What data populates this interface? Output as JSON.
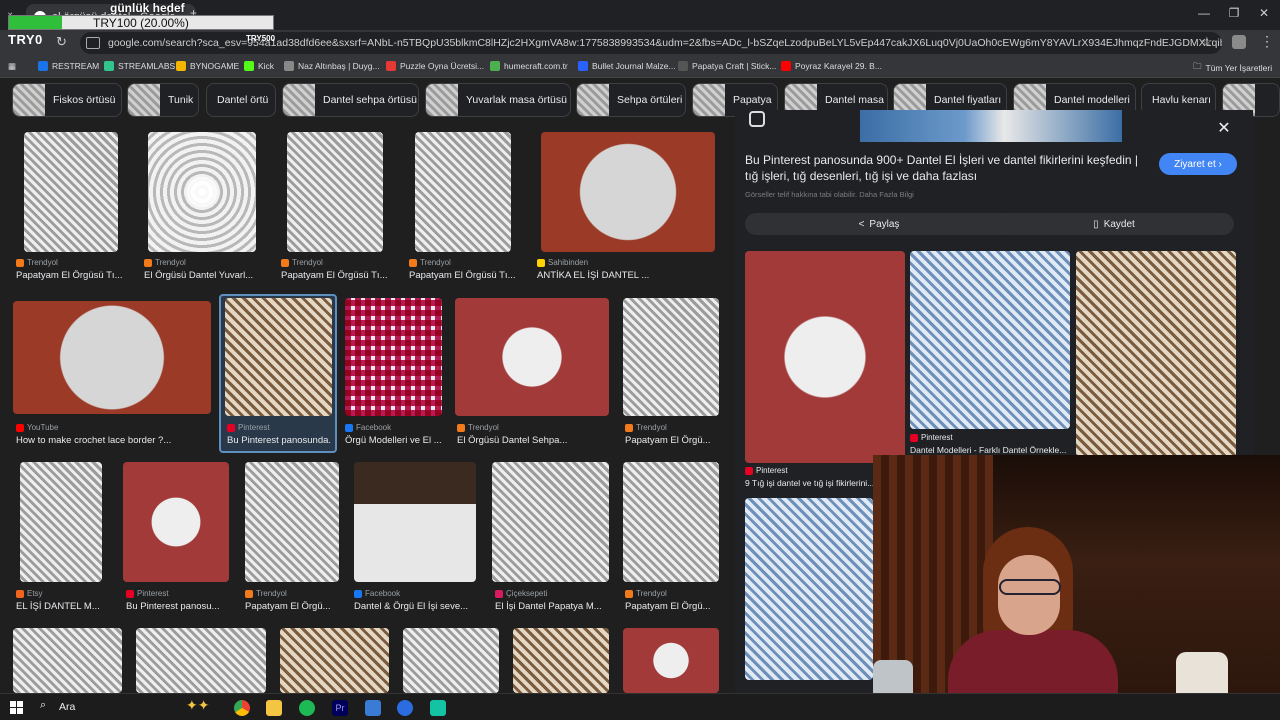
{
  "overlay": {
    "goal_title": "günlük hedef",
    "goal_progress_text": "TRY100 (20.00%)",
    "goal_progress_fraction": 0.2,
    "logo_text": "TRY0",
    "small_text": "TRY500"
  },
  "tab": {
    "title": "el örgüsü dantel - Google"
  },
  "window_controls": {
    "minimize": "—",
    "maximize": "❐",
    "close": "✕"
  },
  "navbar": {
    "url": "google.com/search?sca_esv=954a1ad38dfd6ee&sxsrf=ANbL-n5TBQpU35blkmC8lHZjc2HXgmVA8w:1775838993534&udm=2&fbs=ADc_l-bSZqeLzodpuBeLYL5vEp447cakJX6Luq0Vj0UaOh0cEWg6mY8YAVLrX934EJhmqzFndEJGDMXLqibph2auVEWVCxytnxD5qw_hf..."
  },
  "bookmarks": {
    "items": [
      "RESTREAM",
      "STREAMLABS",
      "BYNOGAME",
      "Kick",
      "Naz Altınbaş | Duyg...",
      "Puzzle Oyna Ücretsi...",
      "humecraft.com.tr",
      "Bullet Journal Malze...",
      "Papatya Craft | Stick...",
      "Poyraz Karayel 29. B..."
    ],
    "all_bookmarks": "Tüm Yer İşaretleri",
    "colors": [
      "#1a73e8",
      "#31c48d",
      "#f4b400",
      "#53fc18",
      "#888888",
      "#e53935",
      "#4caf50",
      "#2962ff",
      "#555555",
      "#ff0000"
    ]
  },
  "chips": [
    "Fiskos örtüsü",
    "Tunik",
    "Dantel örtü",
    "Dantel sehpa örtüsü",
    "Yuvarlak masa örtüsü",
    "Sehpa örtüleri",
    "Papatya",
    "Dantel masa",
    "Dantel fiyatları",
    "Dantel modelleri",
    "Havlu kenarı"
  ],
  "results": [
    {
      "src": "Trendyol",
      "cap": "Papatyam El Örgüsü Tı..."
    },
    {
      "src": "Trendyol",
      "cap": "El Örgüsü Dantel Yuvarl..."
    },
    {
      "src": "Trendyol",
      "cap": "Papatyam El Örgüsü Tı..."
    },
    {
      "src": "Trendyol",
      "cap": "Papatyam El Örgüsü Tı..."
    },
    {
      "src": "Sahibinden",
      "cap": "ANTİKA EL İŞİ DANTEL ..."
    },
    {
      "src": "YouTube",
      "cap": "How to make crochet lace border ?..."
    },
    {
      "src": "Pinterest",
      "cap": "Bu Pinterest panosunda..."
    },
    {
      "src": "Facebook",
      "cap": "Örgü Modelleri ve El ..."
    },
    {
      "src": "Trendyol",
      "cap": "El Örgüsü Dantel Sehpa..."
    },
    {
      "src": "Trendyol",
      "cap": "Papatyam El Örgü..."
    },
    {
      "src": "Etsy",
      "cap": "EL İŞİ DANTEL M..."
    },
    {
      "src": "Pinterest",
      "cap": "Bu Pinterest panosu..."
    },
    {
      "src": "Trendyol",
      "cap": "Papatyam El Örgü..."
    },
    {
      "src": "Facebook",
      "cap": "Dantel & Örgü El İşi seve..."
    },
    {
      "src": "Çiçeksepeti",
      "cap": "El İşi Dantel Papatya M..."
    },
    {
      "src": "Trendyol",
      "cap": "Papatyam El Örgü..."
    }
  ],
  "panel": {
    "title": "Bu Pinterest panosunda 900+ Dantel El İşleri ve dantel fikirlerini keşfedin | tığ işleri, tığ desenleri, tığ işi ve daha fazlası",
    "subtitle": "Görseller telif hakkına tabi olabilir. Daha Fazla Bilgi",
    "visit": "Ziyaret et",
    "share": "Paylaş",
    "save": "Kaydet",
    "related": [
      {
        "src": "Pinterest",
        "cap": "9 Tığ işi dantel ve tığ işi fikirlerini..."
      },
      {
        "src": "Pinterest",
        "cap": "Dantel Modelleri - Farklı Dantel Örnekle..."
      },
      {
        "src": "Pinterest",
        "cap": "..."
      }
    ]
  },
  "taskbar": {
    "search_label": "Ara"
  }
}
